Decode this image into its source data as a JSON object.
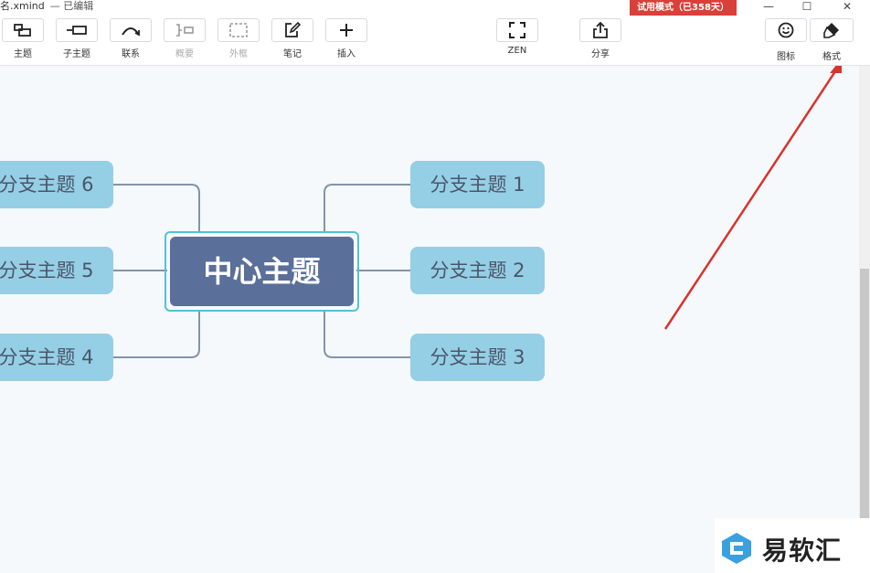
{
  "window": {
    "title": "名.xmind",
    "status": "— 已编辑",
    "trial_badge": "试用模式（已358天）",
    "min_glyph": "—",
    "max_glyph": "☐",
    "close_glyph": "✕"
  },
  "toolbar": {
    "topic": "主题",
    "subtopic": "子主题",
    "relationship": "联系",
    "summary": "概要",
    "boundary": "外框",
    "note": "笔记",
    "insert": "插入",
    "zen": "ZEN",
    "share": "分享",
    "icon": "图标",
    "format": "格式"
  },
  "mindmap": {
    "central": "中心主题",
    "right": [
      "分支主题 1",
      "分支主题 2",
      "分支主题 3"
    ],
    "left": [
      "分支主题 6",
      "分支主题 5",
      "分支主题 4"
    ]
  },
  "annotation": {
    "arrow_color": "#d9332b"
  },
  "colors": {
    "branch_fill": "#95cfe6",
    "central_fill": "#5a6f99",
    "selection": "#4fc3d9",
    "trial_badge": "#d9403a"
  },
  "watermark": {
    "text": "易软汇"
  }
}
